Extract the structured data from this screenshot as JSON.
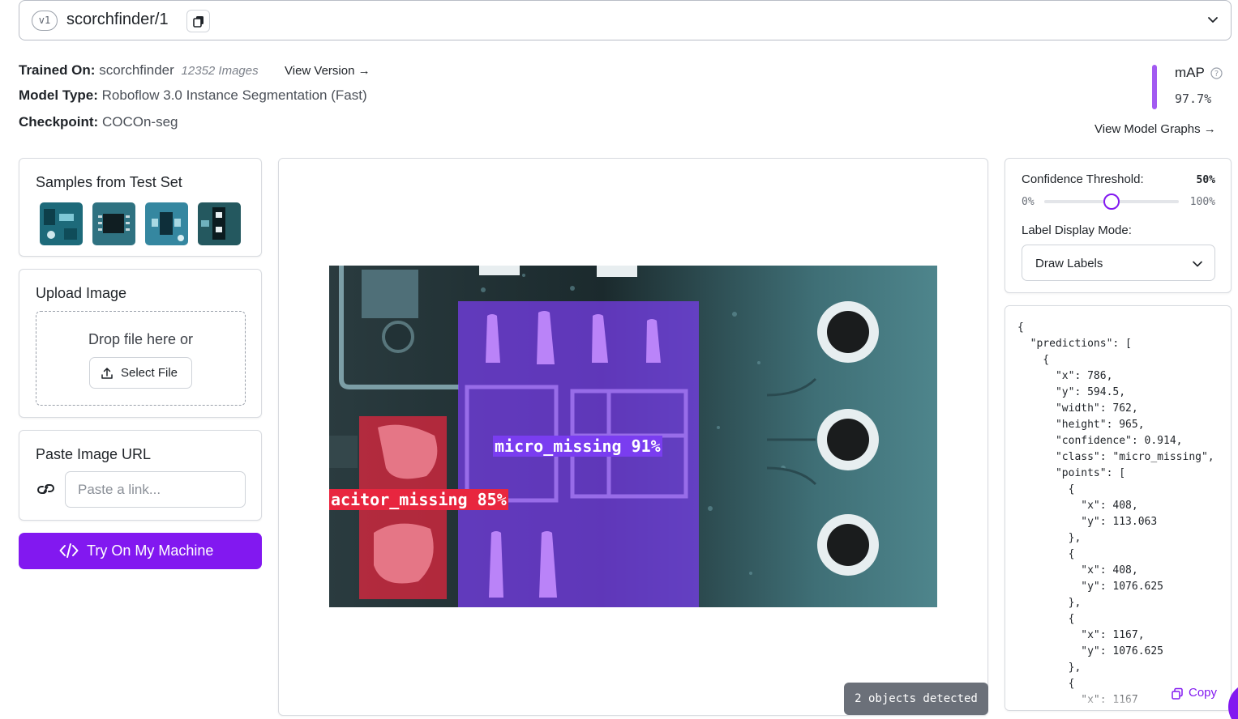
{
  "version": {
    "badge": "v1",
    "name": "scorchfinder/1"
  },
  "info": {
    "trained_on_label": "Trained On:",
    "trained_on_value": "scorchfinder",
    "images_count": "12352 Images",
    "view_version": "View Version →",
    "model_type_label": "Model Type:",
    "model_type_value": "Roboflow 3.0 Instance Segmentation (Fast)",
    "checkpoint_label": "Checkpoint:",
    "checkpoint_value": "COCOn-seg"
  },
  "metrics": {
    "map_label": "mAP",
    "map_value": "97.7%",
    "view_graphs": "View Model Graphs →"
  },
  "samples": {
    "title": "Samples from Test Set"
  },
  "upload": {
    "title": "Upload Image",
    "drop_text": "Drop file here or",
    "select_label": "Select File"
  },
  "paste": {
    "title": "Paste Image URL",
    "placeholder": "Paste a link..."
  },
  "try_button": {
    "label": "Try On My Machine"
  },
  "preview": {
    "detections": [
      {
        "label": "micro_missing 91%",
        "class": "micro_missing",
        "confidence": 0.914,
        "color": "#7a3df0"
      },
      {
        "label": "acitor_missing 85%",
        "class": "capacitor_missing",
        "confidence": 0.85,
        "color": "#e8263f"
      }
    ],
    "objects_detected": "2 objects detected"
  },
  "settings": {
    "confidence_label": "Confidence Threshold:",
    "confidence_value": "50%",
    "confidence_fraction": 0.5,
    "min_label": "0%",
    "max_label": "100%",
    "display_mode_label": "Label Display Mode:",
    "display_mode_value": "Draw Labels"
  },
  "json_output": {
    "text": "{\n  \"predictions\": [\n    {\n      \"x\": 786,\n      \"y\": 594.5,\n      \"width\": 762,\n      \"height\": 965,\n      \"confidence\": 0.914,\n      \"class\": \"micro_missing\",\n      \"points\": [\n        {\n          \"x\": 408,\n          \"y\": 113.063\n        },\n        {\n          \"x\": 408,\n          \"y\": 1076.625\n        },\n        {\n          \"x\": 1167,\n          \"y\": 1076.625\n        },\n        {\n          \"x\": 1167",
    "copy_label": "Copy"
  },
  "colors": {
    "accent": "#8218f0",
    "map_bar": "#a25af1"
  }
}
